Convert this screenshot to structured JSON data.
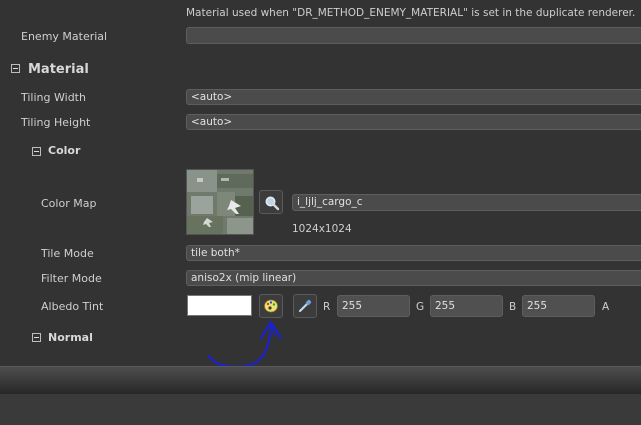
{
  "description_text": "Material used when \"DR_METHOD_ENEMY_MATERIAL\" is set in the duplicate renderer.",
  "enemy_material": {
    "label": "Enemy Material",
    "value": ""
  },
  "material_section": {
    "label": "Material"
  },
  "tiling_width": {
    "label": "Tiling Width",
    "value": "<auto>"
  },
  "tiling_height": {
    "label": "Tiling Height",
    "value": "<auto>"
  },
  "color_section": {
    "label": "Color"
  },
  "color_map": {
    "label": "Color Map",
    "texture_name": "i_ljlj_cargo_c",
    "resolution": "1024x1024"
  },
  "tile_mode": {
    "label": "Tile Mode",
    "value": "tile both*"
  },
  "filter_mode": {
    "label": "Filter Mode",
    "value": "aniso2x (mip linear)"
  },
  "albedo_tint": {
    "label": "Albedo Tint",
    "swatch_color": "#ffffff",
    "r_label": "R",
    "r_value": "255",
    "g_label": "G",
    "g_value": "255",
    "b_label": "B",
    "b_value": "255",
    "a_label": "A"
  },
  "normal_section": {
    "label": "Normal"
  },
  "icons": {
    "browse": "magnifier-icon",
    "color_picker": "palette-icon",
    "eyedropper": "eyedropper-icon",
    "collapse": "minus-box-icon"
  },
  "colors": {
    "panel_bg": "#333333",
    "field_bg": "#4b4b4b",
    "annotation_ink": "#1a22c8"
  }
}
